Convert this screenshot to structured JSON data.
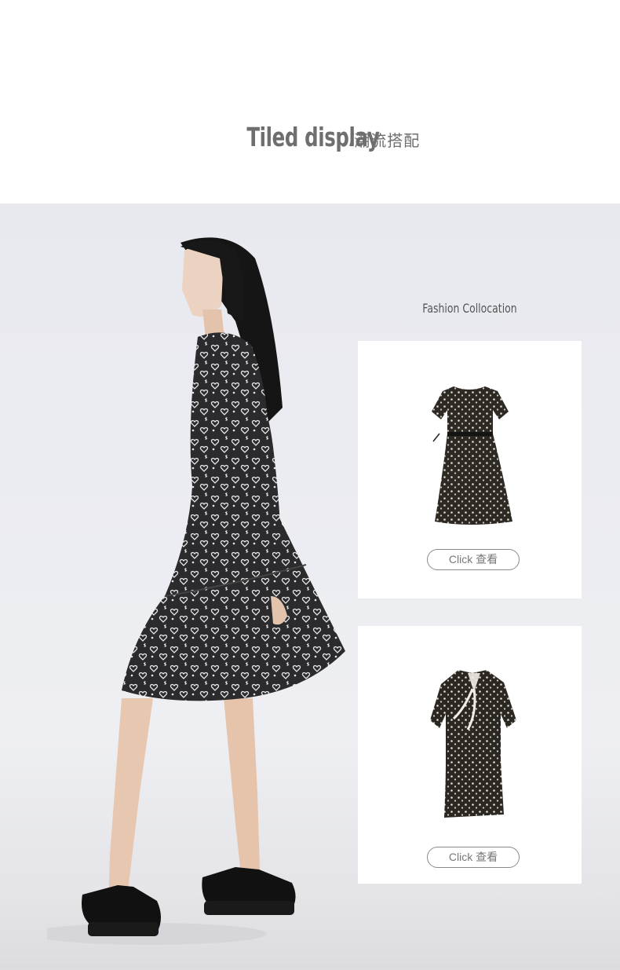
{
  "header": {
    "title_en": "Tiled  display",
    "title_separator": "/",
    "title_cn": "潮流搭配"
  },
  "collocation": {
    "label": "Fashion Collocation",
    "products": [
      {
        "button_label": "Click 查看",
        "icon": "short-sleeve-floral-dress-with-belt"
      },
      {
        "button_label": "Click 查看",
        "icon": "short-sleeve-floral-dress-with-bow-collar"
      }
    ]
  },
  "model_photo": {
    "icon": "model-wearing-heart-print-dress"
  },
  "colors": {
    "title": "#6e6e6e",
    "photo_background": "#eceef2",
    "dress_dark": "#2b2b2e",
    "button_border": "#8a8a8a"
  }
}
